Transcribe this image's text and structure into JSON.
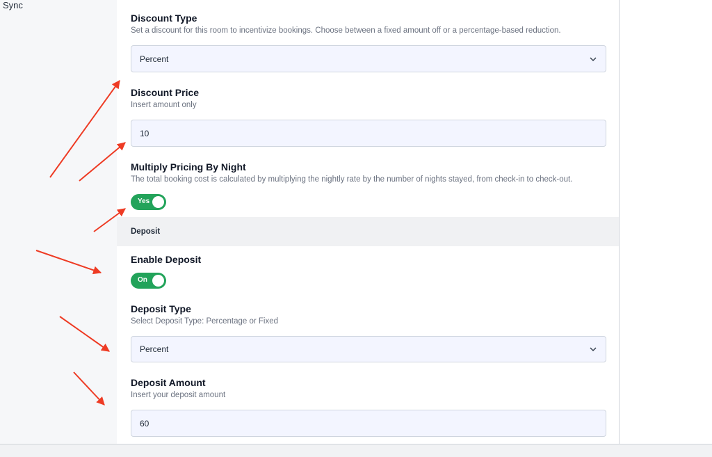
{
  "sidebar": {
    "label": "Sync"
  },
  "discount_type": {
    "title": "Discount Type",
    "description": "Set a discount for this room to incentivize bookings. Choose between a fixed amount off or a percentage-based reduction.",
    "value": "Percent"
  },
  "discount_price": {
    "title": "Discount Price",
    "description": "Insert amount only",
    "value": "10"
  },
  "multiply_pricing": {
    "title": "Multiply Pricing By Night",
    "description": "The total booking cost is calculated by multiplying the nightly rate by the number of nights stayed, from check-in to check-out.",
    "toggle_label": "Yes",
    "enabled": true
  },
  "deposit_section": {
    "heading": "Deposit"
  },
  "enable_deposit": {
    "title": "Enable Deposit",
    "toggle_label": "On",
    "enabled": true
  },
  "deposit_type": {
    "title": "Deposit Type",
    "description": "Select Deposit Type: Percentage or Fixed",
    "value": "Percent"
  },
  "deposit_amount": {
    "title": "Deposit Amount",
    "description": "Insert your deposit amount",
    "value": "60"
  },
  "colors": {
    "toggle_on": "#22a35a",
    "annotation_arrow": "#ee3b24",
    "field_bg": "#f3f5ff"
  }
}
